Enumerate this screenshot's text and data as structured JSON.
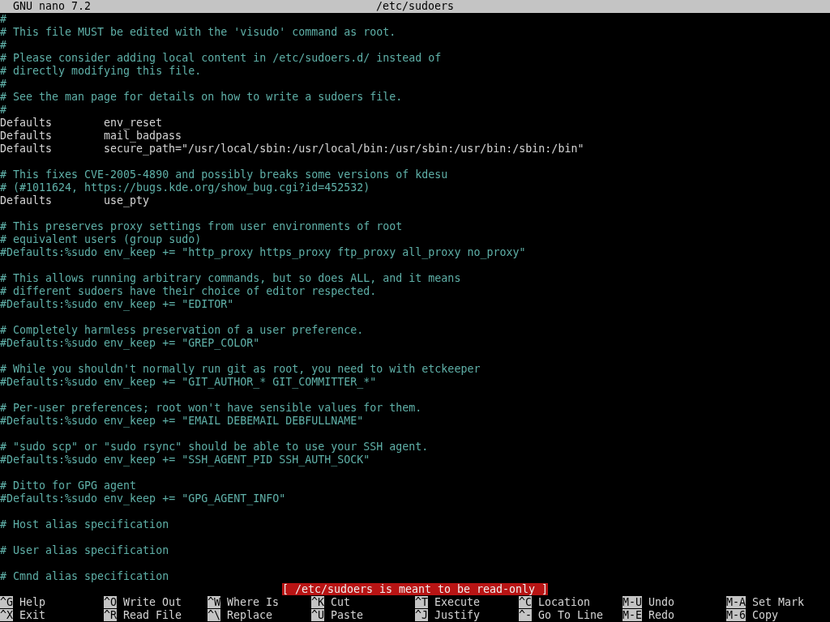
{
  "title_bar": {
    "app": "GNU nano 7.2",
    "file": "/etc/sudoers"
  },
  "lines": [
    {
      "kind": "comment",
      "text": "#"
    },
    {
      "kind": "comment",
      "text": "# This file MUST be edited with the 'visudo' command as root."
    },
    {
      "kind": "comment",
      "text": "#"
    },
    {
      "kind": "comment",
      "text": "# Please consider adding local content in /etc/sudoers.d/ instead of"
    },
    {
      "kind": "comment",
      "text": "# directly modifying this file."
    },
    {
      "kind": "comment",
      "text": "#"
    },
    {
      "kind": "comment",
      "text": "# See the man page for details on how to write a sudoers file."
    },
    {
      "kind": "comment",
      "text": "#"
    },
    {
      "kind": "setting",
      "keyword": "Defaults",
      "value": "env_reset"
    },
    {
      "kind": "setting",
      "keyword": "Defaults",
      "value": "mail_badpass"
    },
    {
      "kind": "setting",
      "keyword": "Defaults",
      "value": "secure_path=\"/usr/local/sbin:/usr/local/bin:/usr/sbin:/usr/bin:/sbin:/bin\""
    },
    {
      "kind": "blank"
    },
    {
      "kind": "comment",
      "text": "# This fixes CVE-2005-4890 and possibly breaks some versions of kdesu"
    },
    {
      "kind": "comment",
      "text": "# (#1011624, https://bugs.kde.org/show_bug.cgi?id=452532)"
    },
    {
      "kind": "setting",
      "keyword": "Defaults",
      "value": "use_pty"
    },
    {
      "kind": "blank"
    },
    {
      "kind": "comment",
      "text": "# This preserves proxy settings from user environments of root"
    },
    {
      "kind": "comment",
      "text": "# equivalent users (group sudo)"
    },
    {
      "kind": "comment",
      "text": "#Defaults:%sudo env_keep += \"http_proxy https_proxy ftp_proxy all_proxy no_proxy\""
    },
    {
      "kind": "blank"
    },
    {
      "kind": "comment",
      "text": "# This allows running arbitrary commands, but so does ALL, and it means"
    },
    {
      "kind": "comment",
      "text": "# different sudoers have their choice of editor respected."
    },
    {
      "kind": "comment",
      "text": "#Defaults:%sudo env_keep += \"EDITOR\""
    },
    {
      "kind": "blank"
    },
    {
      "kind": "comment",
      "text": "# Completely harmless preservation of a user preference."
    },
    {
      "kind": "comment",
      "text": "#Defaults:%sudo env_keep += \"GREP_COLOR\""
    },
    {
      "kind": "blank"
    },
    {
      "kind": "comment",
      "text": "# While you shouldn't normally run git as root, you need to with etckeeper"
    },
    {
      "kind": "comment",
      "text": "#Defaults:%sudo env_keep += \"GIT_AUTHOR_* GIT_COMMITTER_*\""
    },
    {
      "kind": "blank"
    },
    {
      "kind": "comment",
      "text": "# Per-user preferences; root won't have sensible values for them."
    },
    {
      "kind": "comment",
      "text": "#Defaults:%sudo env_keep += \"EMAIL DEBEMAIL DEBFULLNAME\""
    },
    {
      "kind": "blank"
    },
    {
      "kind": "comment",
      "text": "# \"sudo scp\" or \"sudo rsync\" should be able to use your SSH agent."
    },
    {
      "kind": "comment",
      "text": "#Defaults:%sudo env_keep += \"SSH_AGENT_PID SSH_AUTH_SOCK\""
    },
    {
      "kind": "blank"
    },
    {
      "kind": "comment",
      "text": "# Ditto for GPG agent"
    },
    {
      "kind": "comment",
      "text": "#Defaults:%sudo env_keep += \"GPG_AGENT_INFO\""
    },
    {
      "kind": "blank"
    },
    {
      "kind": "comment",
      "text": "# Host alias specification"
    },
    {
      "kind": "blank"
    },
    {
      "kind": "comment",
      "text": "# User alias specification"
    },
    {
      "kind": "blank"
    },
    {
      "kind": "comment",
      "text": "# Cmnd alias specification"
    }
  ],
  "status_message": "[ /etc/sudoers is meant to be read-only ]",
  "shortcuts": [
    [
      {
        "key": "^G",
        "label": "Help"
      },
      {
        "key": "^O",
        "label": "Write Out"
      },
      {
        "key": "^W",
        "label": "Where Is"
      },
      {
        "key": "^K",
        "label": "Cut"
      },
      {
        "key": "^T",
        "label": "Execute"
      },
      {
        "key": "^C",
        "label": "Location"
      },
      {
        "key": "M-U",
        "label": "Undo"
      },
      {
        "key": "M-A",
        "label": "Set Mark"
      }
    ],
    [
      {
        "key": "^X",
        "label": "Exit"
      },
      {
        "key": "^R",
        "label": "Read File"
      },
      {
        "key": "^\\",
        "label": "Replace"
      },
      {
        "key": "^U",
        "label": "Paste"
      },
      {
        "key": "^J",
        "label": "Justify"
      },
      {
        "key": "^-",
        "label": "Go To Line"
      },
      {
        "key": "M-E",
        "label": "Redo"
      },
      {
        "key": "M-6",
        "label": "Copy"
      }
    ]
  ]
}
